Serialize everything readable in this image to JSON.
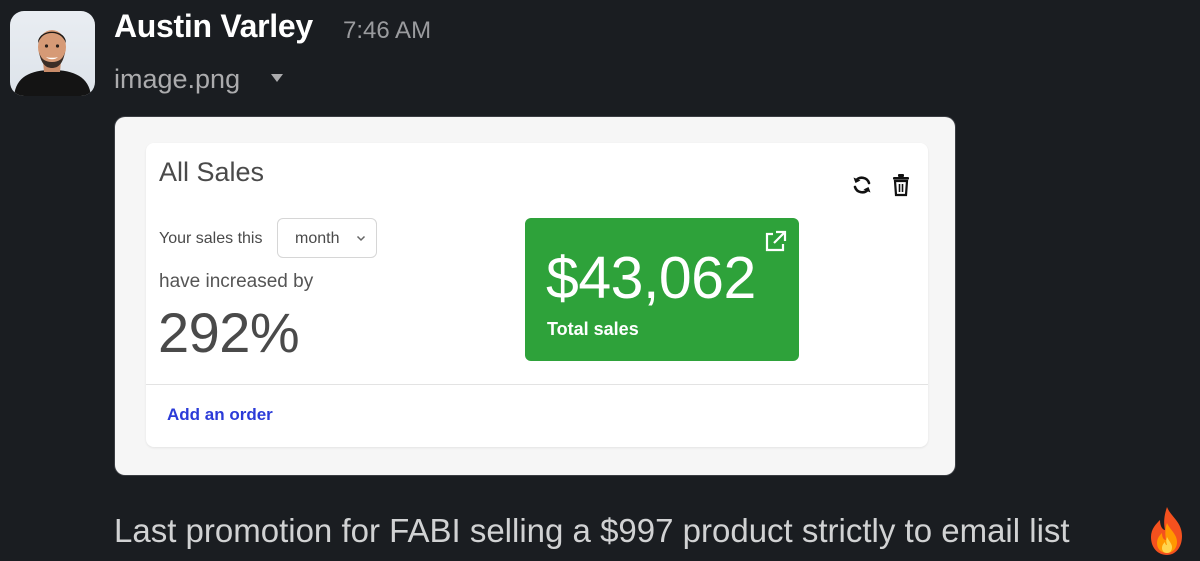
{
  "message": {
    "author": "Austin Varley",
    "timestamp": "7:46 AM",
    "file_name": "image.png",
    "text": "Last promotion for FABI selling a $997 product strictly to email list",
    "reaction_emoji_icon": "fire-icon"
  },
  "widget": {
    "title": "All Sales",
    "sales_prefix": "Your sales this",
    "period_select": {
      "value": "month"
    },
    "increase_label": "have increased by",
    "increase_value": "292%",
    "total_tile": {
      "amount": "$43,062",
      "label": "Total sales",
      "color": "#2ea23a"
    },
    "add_order_link": "Add an order",
    "icons": [
      "refresh-icon",
      "trash-icon",
      "external-link-icon",
      "chevron-down-icon"
    ]
  },
  "colors": {
    "background": "#1a1d21",
    "link": "#2b3bd8"
  }
}
